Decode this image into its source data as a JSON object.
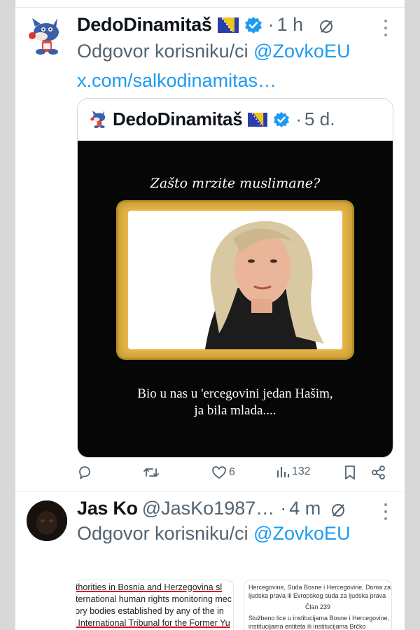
{
  "tweet1": {
    "display_name": "DedoDinamitaš",
    "time": "1 h",
    "reply_prefix": "Odgovor korisniku/ci",
    "reply_mention": "@ZovkoEU",
    "link": "x.com/salkodinamitas…"
  },
  "quote": {
    "display_name": "DedoDinamitaš",
    "time": "5 d.",
    "image_title": "Zašto mrzite muslimane?",
    "caption_line1": "Bio u nas u 'ercegovini jedan Hašim,",
    "caption_line2": "ja bila mlada...."
  },
  "actions": {
    "likes": "6",
    "views": "132"
  },
  "tweet2": {
    "display_name": "Jas Ko",
    "handle": "@JasKo1987…",
    "time": "4 m",
    "reply_prefix": "Odgovor korisniku/ci",
    "reply_mention": "@ZovkoEU"
  },
  "attachment_left": {
    "lines": [
      "uthorities in Bosnia and Herzegovina sl",
      "nternational human rights monitoring mec",
      "sory bodies established by any of the in",
      "e International Tribunal for the Former Yu"
    ]
  },
  "attachment_right": {
    "line1": "Hercegovine, Suda Bosne i Hercegovine, Doma za",
    "line2": "ljudska prava ili Evropskog suda za ljudska prava",
    "article": "Član 239",
    "line3": "Službeno lice u institucijama Bosne i Hercegovine,",
    "line4": "institucijama entiteta ili institucijama Brčko"
  },
  "colors": {
    "accent": "#1d9bf0",
    "secondary_text": "#536471",
    "primary_text": "#0f1419"
  }
}
